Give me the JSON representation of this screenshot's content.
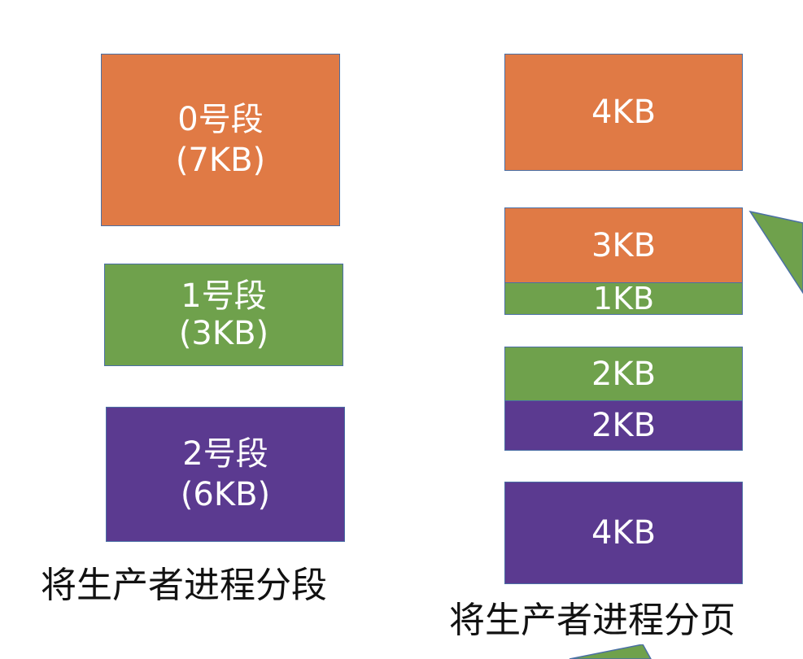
{
  "colors": {
    "orange": "#e07a45",
    "green": "#6fa14c",
    "purple": "#5b3a90",
    "border": "#4a6fa5"
  },
  "segments": {
    "seg0": {
      "name": "0号段",
      "size": "(7KB)"
    },
    "seg1": {
      "name": "1号段",
      "size": "(3KB)"
    },
    "seg2": {
      "name": "2号段",
      "size": "(6KB)"
    }
  },
  "pages": {
    "p1": "4KB",
    "p2_top": "3KB",
    "p2_bottom": "1KB",
    "p3_top": "2KB",
    "p3_bottom": "2KB",
    "p4": "4KB"
  },
  "captions": {
    "segment": "将生产者进程分段",
    "page": "将生产者进程分页"
  }
}
